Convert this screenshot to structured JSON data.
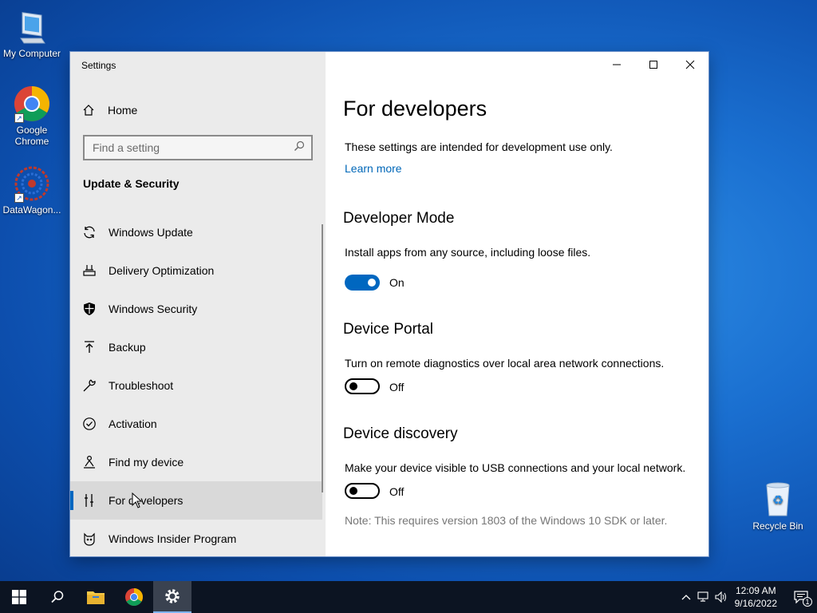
{
  "desktop": {
    "icons": [
      {
        "label": "My Computer"
      },
      {
        "label": "Google Chrome"
      },
      {
        "label": "DataWagon..."
      },
      {
        "label": "Recycle Bin"
      }
    ]
  },
  "window": {
    "title": "Settings"
  },
  "sidebar": {
    "home_label": "Home",
    "search_placeholder": "Find a setting",
    "section_title": "Update & Security",
    "items": [
      {
        "label": "Windows Update",
        "icon": "sync-icon"
      },
      {
        "label": "Delivery Optimization",
        "icon": "delivery-icon"
      },
      {
        "label": "Windows Security",
        "icon": "shield-icon"
      },
      {
        "label": "Backup",
        "icon": "backup-arrow-icon"
      },
      {
        "label": "Troubleshoot",
        "icon": "wrench-icon"
      },
      {
        "label": "Activation",
        "icon": "check-circle-icon"
      },
      {
        "label": "Find my device",
        "icon": "person-locate-icon"
      },
      {
        "label": "For developers",
        "icon": "developer-tools-icon",
        "selected": true
      },
      {
        "label": "Windows Insider Program",
        "icon": "insider-cat-icon"
      }
    ]
  },
  "content": {
    "page_title": "For developers",
    "intro": "These settings are intended for development use only.",
    "learn_more": "Learn more",
    "developer_mode": {
      "heading": "Developer Mode",
      "description": "Install apps from any source, including loose files.",
      "state_label": "On",
      "enabled": true
    },
    "device_portal": {
      "heading": "Device Portal",
      "description": "Turn on remote diagnostics over local area network connections.",
      "state_label": "Off",
      "enabled": false
    },
    "device_discovery": {
      "heading": "Device discovery",
      "description": "Make your device visible to USB connections and your local network.",
      "state_label": "Off",
      "enabled": false,
      "note": "Note: This requires version 1803 of the Windows 10 SDK or later."
    }
  },
  "taskbar": {
    "time": "12:09 AM",
    "date": "9/16/2022",
    "notification_count": "1"
  },
  "colors": {
    "accent": "#0067c0",
    "link": "#0067b8",
    "sidebar_bg": "#ebebeb",
    "taskbar_bg": "#0c1422"
  }
}
